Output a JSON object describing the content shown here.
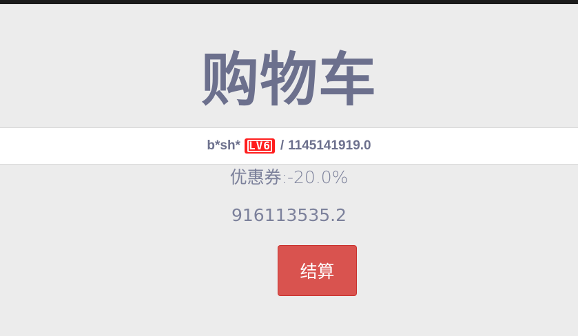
{
  "page": {
    "title": "购物车"
  },
  "user": {
    "name": "b*sh*",
    "level_badge": "LV6",
    "separator": "/",
    "balance": "1145141919.0"
  },
  "cart": {
    "coupon": "优惠券:-20.0%",
    "total": "916113535.2",
    "checkout_label": "结算"
  },
  "colors": {
    "background": "#ececec",
    "title": "#6c708d",
    "badge": "#ff1e1e",
    "checkout_button": "#d9534f"
  }
}
